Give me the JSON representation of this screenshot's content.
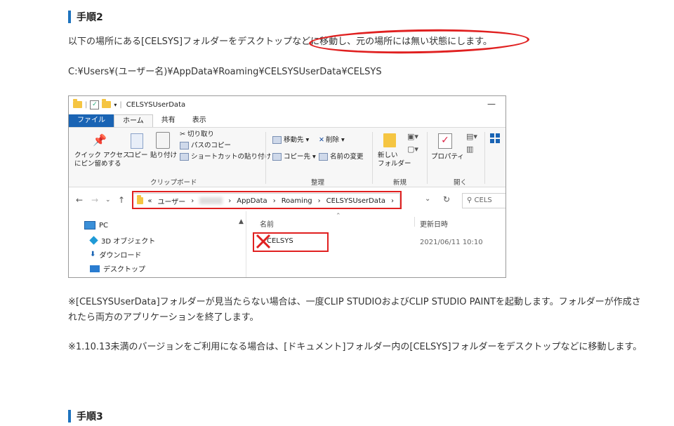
{
  "step2": {
    "title": "手順2"
  },
  "para1": "以下の場所にある[CELSYS]フォルダーをデスクトップなどに移動し、元の場所には無い状態にします。",
  "path": "C:¥Users¥(ユーザー名)¥AppData¥Roaming¥CELSYSUserData¥CELSYS",
  "explorer": {
    "window_title": "CELSYSUserData",
    "minimize": "—",
    "tabs": [
      "ファイル",
      "ホーム",
      "共有",
      "表示"
    ],
    "ribbon": {
      "quick_access_line1": "クイック アクセス",
      "quick_access_line2": "にピン留めする",
      "copy": "コピー",
      "paste": "貼り付け",
      "cut": "切り取り",
      "copy_path": "パスのコピー",
      "paste_shortcut": "ショートカットの貼り付け",
      "clipboard_group": "クリップボード",
      "move_to": "移動先",
      "delete": "削除",
      "copy_to": "コピー先",
      "rename": "名前の変更",
      "organize_group": "整理",
      "new_folder_line1": "新しい",
      "new_folder_line2": "フォルダー",
      "new_group": "新規",
      "properties": "プロパティ",
      "open_group": "開く"
    },
    "address": {
      "prefix": "«",
      "segments": [
        "ユーザー",
        "AppData",
        "Roaming",
        "CELSYSUserData"
      ],
      "separator": "›",
      "search_placeholder": "CELS"
    },
    "nav_items": [
      "PC",
      "3D オブジェクト",
      "ダウンロード",
      "デスクトップ"
    ],
    "columns": {
      "name": "名前",
      "date": "更新日時"
    },
    "file": {
      "name": "CELSYS",
      "date": "2021/06/11 10:10"
    }
  },
  "note1": "※[CELSYSUserData]フォルダーが見当たらない場合は、一度CLIP STUDIOおよびCLIP STUDIO PAINTを起動します。フォルダーが作成されたら両方のアプリケーションを終了します。",
  "note2": "※1.10.13未満のバージョンをご利用になる場合は、[ドキュメント]フォルダー内の[CELSYS]フォルダーをデスクトップなどに移動します。",
  "step3": {
    "title": "手順3"
  },
  "colors": {
    "accent": "#1e73be",
    "annotation": "#e02020"
  }
}
